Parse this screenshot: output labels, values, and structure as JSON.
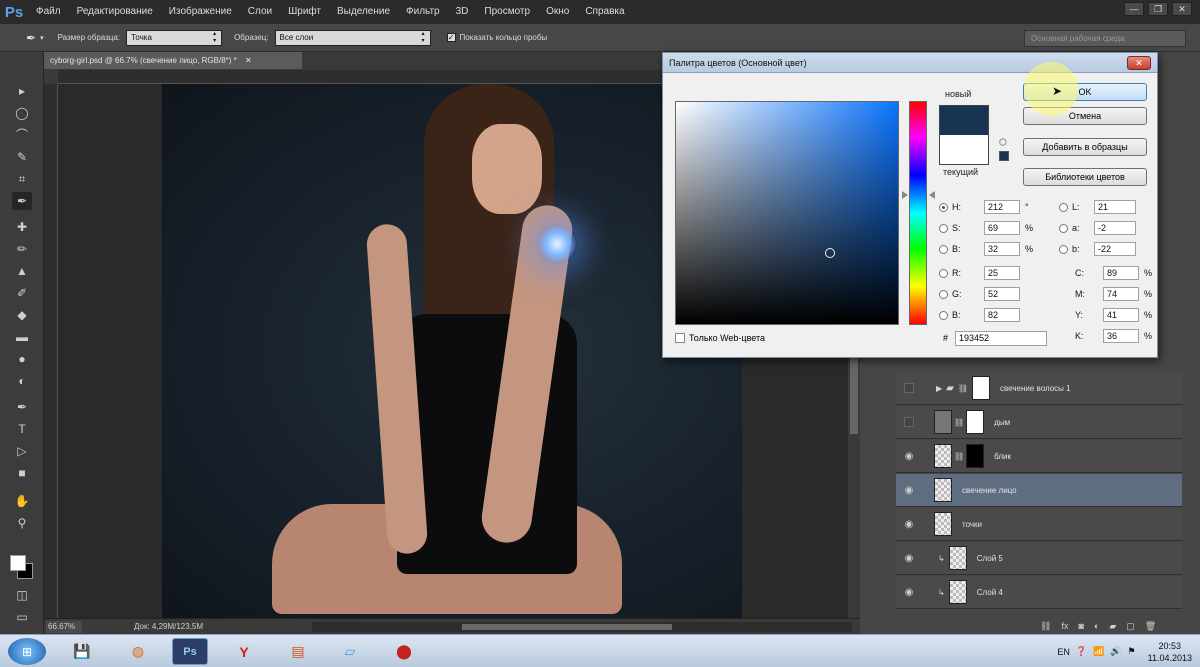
{
  "app": {
    "logo": "Ps"
  },
  "menu": [
    "Файл",
    "Редактирование",
    "Изображение",
    "Слои",
    "Шрифт",
    "Выделение",
    "Фильтр",
    "3D",
    "Просмотр",
    "Окно",
    "Справка"
  ],
  "window_controls": [
    "—",
    "❐",
    "✕"
  ],
  "options": {
    "sample_size_label": "Размер образца:",
    "sample_size_value": "Точка",
    "sample_label": "Образец:",
    "sample_value": "Все слои",
    "show_ring_label": "Показать кольцо пробы",
    "workspace": "Основная рабочая среда"
  },
  "document": {
    "tab_title": "cyborg-girl.psd @ 66.7% (свечение лицо, RGB/8*) *",
    "zoom": "66.67%",
    "doc_info": "Док: 4,29M/123,5M"
  },
  "layers": [
    {
      "name": "свечение волосы 1",
      "visible": false,
      "type": "group"
    },
    {
      "name": "дым",
      "visible": false,
      "type": "mask"
    },
    {
      "name": "блик",
      "visible": true,
      "type": "mask"
    },
    {
      "name": "свечение лицо",
      "visible": true,
      "type": "plain",
      "selected": true
    },
    {
      "name": "точки",
      "visible": true,
      "type": "plain"
    },
    {
      "name": "Слой 5",
      "visible": true,
      "type": "clip"
    },
    {
      "name": "Слой 4",
      "visible": true,
      "type": "clip"
    }
  ],
  "picker": {
    "title": "Палитра цветов (Основной цвет)",
    "close": "✕",
    "new_label": "новый",
    "current_label": "текущий",
    "new_color": "#193452",
    "current_color": "#ffffff",
    "buttons": {
      "ok": "OK",
      "cancel": "Отмена",
      "add_to_swatches": "Добавить в образцы",
      "libraries": "Библиотеки цветов"
    },
    "hsb": [
      {
        "label": "H:",
        "value": "212",
        "unit": "°",
        "selected": true
      },
      {
        "label": "S:",
        "value": "69",
        "unit": "%"
      },
      {
        "label": "B:",
        "value": "32",
        "unit": "%"
      }
    ],
    "rgb": [
      {
        "label": "R:",
        "value": "25"
      },
      {
        "label": "G:",
        "value": "52"
      },
      {
        "label": "B:",
        "value": "82"
      }
    ],
    "lab": [
      {
        "label": "L:",
        "value": "21"
      },
      {
        "label": "a:",
        "value": "-2"
      },
      {
        "label": "b:",
        "value": "-22"
      }
    ],
    "cmyk": [
      {
        "label": "C:",
        "value": "89",
        "unit": "%"
      },
      {
        "label": "M:",
        "value": "74",
        "unit": "%"
      },
      {
        "label": "Y:",
        "value": "41",
        "unit": "%"
      },
      {
        "label": "K:",
        "value": "36",
        "unit": "%"
      }
    ],
    "hex_label": "#",
    "hex_value": "193452",
    "web_only_label": "Только Web-цвета"
  },
  "taskbar": {
    "lang": "EN",
    "time": "20:53",
    "date": "11.04.2013"
  }
}
